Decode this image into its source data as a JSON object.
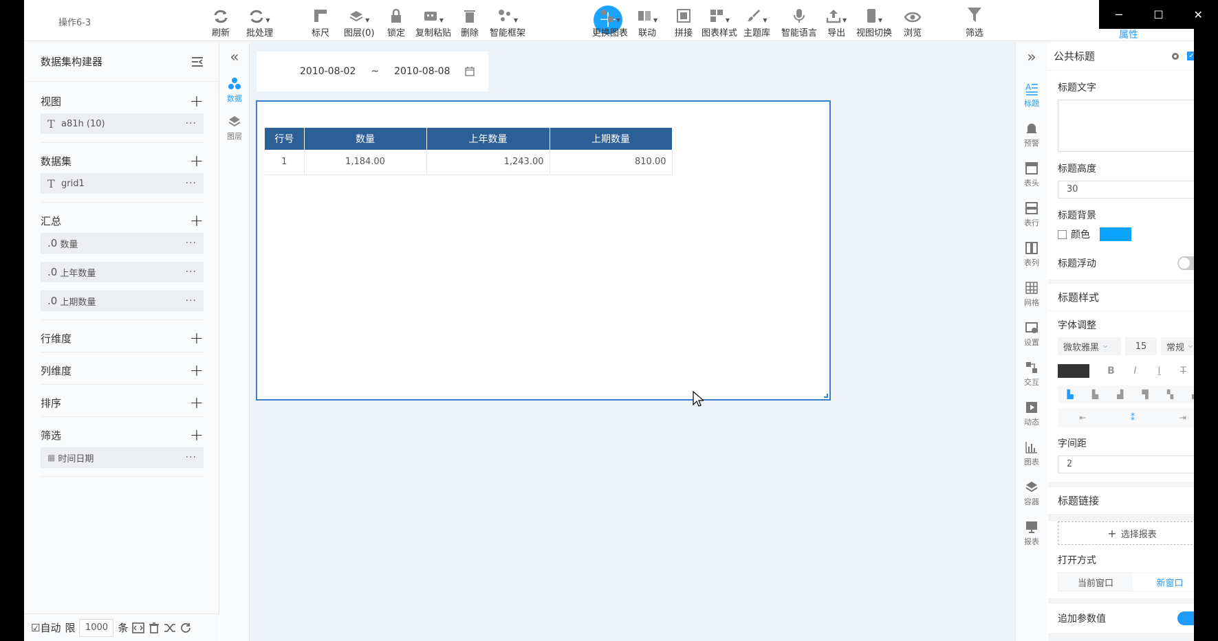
{
  "window": {
    "title": "操作6-3",
    "minimize": "─",
    "maximize": "☐",
    "close": "✕"
  },
  "toolbar": {
    "refresh": "刷新",
    "batch": "批处理",
    "ruler": "标尺",
    "layers": "图层(0)",
    "lock": "锁定",
    "copy_paste": "复制粘贴",
    "delete": "删除",
    "smart_frame": "智能框架",
    "add": "+",
    "change_chart": "更换图表",
    "link": "联动",
    "splice": "拼接",
    "chart_style": "图表样式",
    "theme": "主题库",
    "smart_voice": "智能语言",
    "export": "导出",
    "view_switch": "视图切换",
    "browse": "浏览",
    "filter": "筛选",
    "attributes": "属性"
  },
  "left_panel": {
    "title": "数据集构建器",
    "add_symbol": "+",
    "more_symbol": "···",
    "view": {
      "label": "视图",
      "items": [
        {
          "prefix": "T",
          "text": "a81h (10)"
        }
      ]
    },
    "dataset": {
      "label": "数据集",
      "items": [
        {
          "prefix": "T",
          "text": "grid1"
        }
      ]
    },
    "summary": {
      "label": "汇总",
      "items": [
        {
          "prefix": ".0",
          "text": "数量"
        },
        {
          "prefix": ".0",
          "text": "上年数量"
        },
        {
          "prefix": ".0",
          "text": "上期数量"
        }
      ]
    },
    "row_dim": {
      "label": "行维度"
    },
    "col_dim": {
      "label": "列维度"
    },
    "sort": {
      "label": "排序"
    },
    "filter": {
      "label": "筛选",
      "items": [
        {
          "prefix": "▦",
          "text": "时间日期"
        }
      ]
    },
    "footer": {
      "auto": "☑自动",
      "limit": "限",
      "limit_value": "1000",
      "unit": "条"
    }
  },
  "rail2": {
    "collapse": "«",
    "data": "数据",
    "layers": "图层"
  },
  "canvas": {
    "date_from": "2010-08-02",
    "tilde": "~",
    "date_to": "2010-08-08",
    "table": {
      "headers": [
        "行号",
        "数量",
        "上年数量",
        "上期数量"
      ],
      "rows": [
        [
          "1",
          "1,184.00",
          "1,243.00",
          "810.00"
        ]
      ]
    }
  },
  "rail3": {
    "expand": "»",
    "items": [
      "标题",
      "预警",
      "表头",
      "表行",
      "表列",
      "网格",
      "设置",
      "交互",
      "动态",
      "图表",
      "容器",
      "报表"
    ]
  },
  "props": {
    "header": "公共标题",
    "title_text": "标题文字",
    "title_height": "标题高度",
    "title_height_value": "30",
    "title_bg": "标题背景",
    "color_label": "颜色",
    "title_float": "标题浮动",
    "title_style": "标题样式",
    "font_adjust": "字体调整",
    "font_name": "微软雅黑",
    "font_size": "15",
    "font_weight": "常规",
    "letter_spacing": "字间距",
    "letter_spacing_value": "2",
    "title_link": "标题链接",
    "select_report": "选择报表",
    "open_mode": "打开方式",
    "current_window": "当前窗口",
    "new_window": "新窗口",
    "append_params": "追加参数值"
  },
  "colors": {
    "accent": "#1f9bff",
    "table_header": "#2c5f95",
    "title_bg_swatch": "#0aa4ff"
  }
}
